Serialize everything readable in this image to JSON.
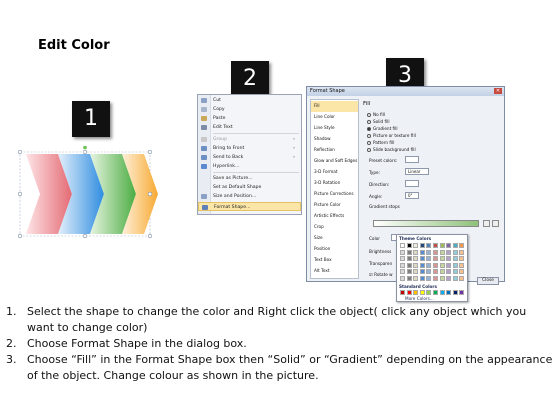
{
  "title": "Edit Color",
  "steps": [
    "1",
    "2",
    "3"
  ],
  "context_menu": {
    "items": [
      {
        "label": "Cut",
        "icon": "scissors-icon"
      },
      {
        "label": "Copy",
        "icon": "copy-icon"
      },
      {
        "label": "Paste",
        "icon": "paste-icon"
      },
      {
        "label": "Edit Text",
        "icon": "edit-text-icon"
      },
      {
        "label": "Group",
        "icon": "group-icon",
        "disabled": true
      },
      {
        "label": "Bring to Front",
        "icon": "bring-front-icon",
        "submenu": true
      },
      {
        "label": "Send to Back",
        "icon": "send-back-icon",
        "submenu": true
      },
      {
        "label": "Hyperlink...",
        "icon": "hyperlink-icon"
      },
      {
        "label": "Save as Picture...",
        "icon": ""
      },
      {
        "label": "Set as Default Shape",
        "icon": ""
      },
      {
        "label": "Size and Position...",
        "icon": "size-icon"
      },
      {
        "label": "Format Shape...",
        "icon": "format-shape-icon",
        "highlight": true
      }
    ]
  },
  "dialog": {
    "title": "Format Shape",
    "close_glyph": "✕",
    "sidebar": [
      "Fill",
      "Line Color",
      "Line Style",
      "Shadow",
      "Reflection",
      "Glow and Soft Edges",
      "3-D Format",
      "3-D Rotation",
      "Picture Corrections",
      "Picture Color",
      "Artistic Effects",
      "Crop",
      "Size",
      "Position",
      "Text Box",
      "Alt Text"
    ],
    "fill_heading": "Fill",
    "fill_options": [
      {
        "label": "No fill",
        "selected": false
      },
      {
        "label": "Solid fill",
        "selected": false
      },
      {
        "label": "Gradient fill",
        "selected": true
      },
      {
        "label": "Picture or texture fill",
        "selected": false
      },
      {
        "label": "Pattern fill",
        "selected": false
      },
      {
        "label": "Slide background fill",
        "selected": false
      }
    ],
    "preset_colors_label": "Preset colors:",
    "type_label": "Type:",
    "type_value": "Linear",
    "direction_label": "Direction:",
    "angle_label": "Angle:",
    "angle_value": "0°",
    "gradient_stops_label": "Gradient stops",
    "color_label": "Color",
    "position_label": "Position:",
    "position_value": "0%",
    "brightness_label": "Brightness",
    "transparency_label": "Transparen",
    "rotate_label": "Rotate w",
    "close_label": "Close"
  },
  "picker": {
    "theme_label": "Theme Colors",
    "standard_label": "Standard Colors",
    "more_label": "More Colors...",
    "theme_top": [
      "#ffffff",
      "#000000",
      "#eeece1",
      "#1f497d",
      "#4f81bd",
      "#c0504d",
      "#9bbb59",
      "#8064a2",
      "#4bacc6",
      "#f79646"
    ],
    "theme_shades": [
      "#d9d9d9",
      "#7f7f7f",
      "#ddd9c3",
      "#548dd4",
      "#95b3d7",
      "#d99694",
      "#c3d69b",
      "#b2a2c7",
      "#92cddc",
      "#fac08f"
    ],
    "standard": [
      "#c00000",
      "#ff0000",
      "#ffc000",
      "#ffff00",
      "#92d050",
      "#00b050",
      "#00b0f0",
      "#0070c0",
      "#002060",
      "#7030a0"
    ]
  },
  "instructions": [
    {
      "num": "1.",
      "text": "Select the shape to change the color and Right click the object( click any object which you want to change color)"
    },
    {
      "num": "2.",
      "text": "Choose Format Shape in the dialog box."
    },
    {
      "num": "3.",
      "text": "Choose “Fill” in the Format Shape box then “Solid” or “Gradient” depending on the appearance of the object. Change colour as shown in the picture."
    }
  ]
}
